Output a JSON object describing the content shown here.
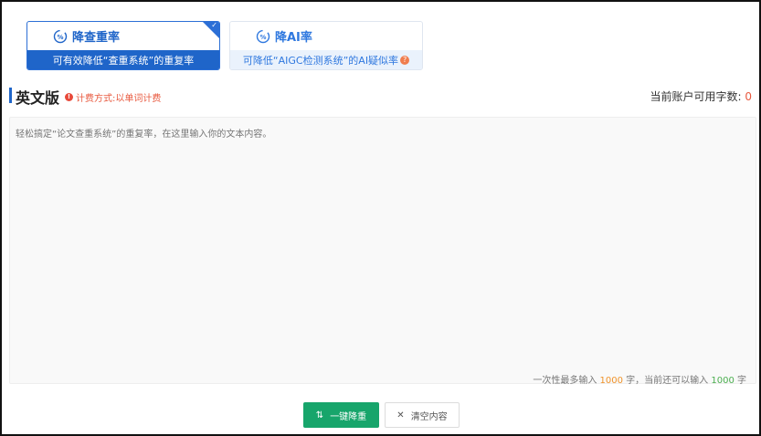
{
  "modes": [
    {
      "title": "降查重率",
      "subtitle": "可有效降低“查重系统”的重复率",
      "active": true
    },
    {
      "title": "降AI率",
      "subtitle": "可降低“AIGC检测系统”的AI疑似率",
      "active": false
    }
  ],
  "section": {
    "title": "英文版",
    "billing_note": "计费方式:以单词计费",
    "quota_label": "当前账户可用字数:",
    "quota_value": "0"
  },
  "editor": {
    "placeholder": "轻松搞定“论文查重系统”的重复率，在这里输入你的文本内容。",
    "counter_prefix": "一次性最多输入",
    "counter_max": "1000",
    "counter_mid": "字，当前还可以输入",
    "counter_remaining": "1000",
    "counter_suffix": "字"
  },
  "actions": {
    "primary_label": "一键降重",
    "secondary_label": "清空内容"
  },
  "colors": {
    "brand_blue": "#1f65c9",
    "primary_green": "#17a56b",
    "warning_red": "#e8593f"
  }
}
